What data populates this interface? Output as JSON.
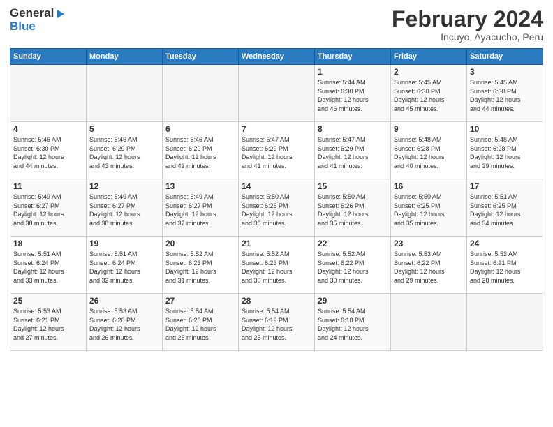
{
  "header": {
    "logo_line1": "General",
    "logo_line2": "Blue",
    "month_title": "February 2024",
    "subtitle": "Incuyo, Ayacucho, Peru"
  },
  "weekdays": [
    "Sunday",
    "Monday",
    "Tuesday",
    "Wednesday",
    "Thursday",
    "Friday",
    "Saturday"
  ],
  "weeks": [
    [
      {
        "day": "",
        "info": ""
      },
      {
        "day": "",
        "info": ""
      },
      {
        "day": "",
        "info": ""
      },
      {
        "day": "",
        "info": ""
      },
      {
        "day": "1",
        "info": "Sunrise: 5:44 AM\nSunset: 6:30 PM\nDaylight: 12 hours\nand 46 minutes."
      },
      {
        "day": "2",
        "info": "Sunrise: 5:45 AM\nSunset: 6:30 PM\nDaylight: 12 hours\nand 45 minutes."
      },
      {
        "day": "3",
        "info": "Sunrise: 5:45 AM\nSunset: 6:30 PM\nDaylight: 12 hours\nand 44 minutes."
      }
    ],
    [
      {
        "day": "4",
        "info": "Sunrise: 5:46 AM\nSunset: 6:30 PM\nDaylight: 12 hours\nand 44 minutes."
      },
      {
        "day": "5",
        "info": "Sunrise: 5:46 AM\nSunset: 6:29 PM\nDaylight: 12 hours\nand 43 minutes."
      },
      {
        "day": "6",
        "info": "Sunrise: 5:46 AM\nSunset: 6:29 PM\nDaylight: 12 hours\nand 42 minutes."
      },
      {
        "day": "7",
        "info": "Sunrise: 5:47 AM\nSunset: 6:29 PM\nDaylight: 12 hours\nand 41 minutes."
      },
      {
        "day": "8",
        "info": "Sunrise: 5:47 AM\nSunset: 6:29 PM\nDaylight: 12 hours\nand 41 minutes."
      },
      {
        "day": "9",
        "info": "Sunrise: 5:48 AM\nSunset: 6:28 PM\nDaylight: 12 hours\nand 40 minutes."
      },
      {
        "day": "10",
        "info": "Sunrise: 5:48 AM\nSunset: 6:28 PM\nDaylight: 12 hours\nand 39 minutes."
      }
    ],
    [
      {
        "day": "11",
        "info": "Sunrise: 5:49 AM\nSunset: 6:27 PM\nDaylight: 12 hours\nand 38 minutes."
      },
      {
        "day": "12",
        "info": "Sunrise: 5:49 AM\nSunset: 6:27 PM\nDaylight: 12 hours\nand 38 minutes."
      },
      {
        "day": "13",
        "info": "Sunrise: 5:49 AM\nSunset: 6:27 PM\nDaylight: 12 hours\nand 37 minutes."
      },
      {
        "day": "14",
        "info": "Sunrise: 5:50 AM\nSunset: 6:26 PM\nDaylight: 12 hours\nand 36 minutes."
      },
      {
        "day": "15",
        "info": "Sunrise: 5:50 AM\nSunset: 6:26 PM\nDaylight: 12 hours\nand 35 minutes."
      },
      {
        "day": "16",
        "info": "Sunrise: 5:50 AM\nSunset: 6:25 PM\nDaylight: 12 hours\nand 35 minutes."
      },
      {
        "day": "17",
        "info": "Sunrise: 5:51 AM\nSunset: 6:25 PM\nDaylight: 12 hours\nand 34 minutes."
      }
    ],
    [
      {
        "day": "18",
        "info": "Sunrise: 5:51 AM\nSunset: 6:24 PM\nDaylight: 12 hours\nand 33 minutes."
      },
      {
        "day": "19",
        "info": "Sunrise: 5:51 AM\nSunset: 6:24 PM\nDaylight: 12 hours\nand 32 minutes."
      },
      {
        "day": "20",
        "info": "Sunrise: 5:52 AM\nSunset: 6:23 PM\nDaylight: 12 hours\nand 31 minutes."
      },
      {
        "day": "21",
        "info": "Sunrise: 5:52 AM\nSunset: 6:23 PM\nDaylight: 12 hours\nand 30 minutes."
      },
      {
        "day": "22",
        "info": "Sunrise: 5:52 AM\nSunset: 6:22 PM\nDaylight: 12 hours\nand 30 minutes."
      },
      {
        "day": "23",
        "info": "Sunrise: 5:53 AM\nSunset: 6:22 PM\nDaylight: 12 hours\nand 29 minutes."
      },
      {
        "day": "24",
        "info": "Sunrise: 5:53 AM\nSunset: 6:21 PM\nDaylight: 12 hours\nand 28 minutes."
      }
    ],
    [
      {
        "day": "25",
        "info": "Sunrise: 5:53 AM\nSunset: 6:21 PM\nDaylight: 12 hours\nand 27 minutes."
      },
      {
        "day": "26",
        "info": "Sunrise: 5:53 AM\nSunset: 6:20 PM\nDaylight: 12 hours\nand 26 minutes."
      },
      {
        "day": "27",
        "info": "Sunrise: 5:54 AM\nSunset: 6:20 PM\nDaylight: 12 hours\nand 25 minutes."
      },
      {
        "day": "28",
        "info": "Sunrise: 5:54 AM\nSunset: 6:19 PM\nDaylight: 12 hours\nand 25 minutes."
      },
      {
        "day": "29",
        "info": "Sunrise: 5:54 AM\nSunset: 6:18 PM\nDaylight: 12 hours\nand 24 minutes."
      },
      {
        "day": "",
        "info": ""
      },
      {
        "day": "",
        "info": ""
      }
    ]
  ]
}
